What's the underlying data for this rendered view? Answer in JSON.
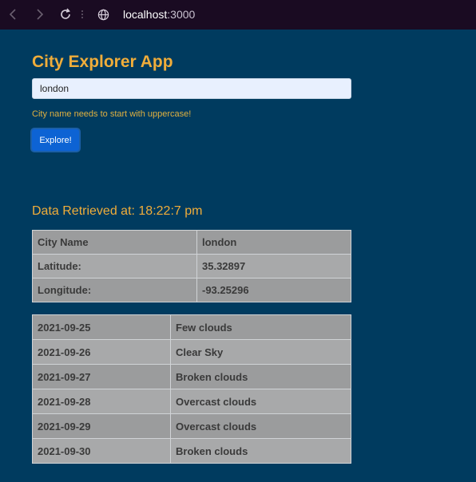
{
  "browser": {
    "url_host": "localhost",
    "url_port": ":3000"
  },
  "app": {
    "title": "City Explorer App",
    "search_value": "london",
    "validation_message": "City name needs to start with uppercase!",
    "explore_label": "Explore!",
    "retrieved_text": "Data Retrieved at: 18:22:7 pm"
  },
  "city_info": [
    {
      "label": "City Name",
      "value": "london"
    },
    {
      "label": "Latitude:",
      "value": "35.32897"
    },
    {
      "label": "Longitude:",
      "value": "-93.25296"
    }
  ],
  "forecast": [
    {
      "date": "2021-09-25",
      "description": "Few clouds"
    },
    {
      "date": "2021-09-26",
      "description": "Clear Sky"
    },
    {
      "date": "2021-09-27",
      "description": "Broken clouds"
    },
    {
      "date": "2021-09-28",
      "description": "Overcast clouds"
    },
    {
      "date": "2021-09-29",
      "description": "Overcast clouds"
    },
    {
      "date": "2021-09-30",
      "description": "Broken clouds"
    }
  ],
  "icons": [
    "back-icon",
    "forward-icon",
    "reload-icon",
    "more-vertical-icon",
    "globe-icon"
  ],
  "colors": {
    "page_background": "#003b5f",
    "accent": "#f0ad3a",
    "button": "#0d63d4",
    "browser_bar": "#1a0b22"
  }
}
